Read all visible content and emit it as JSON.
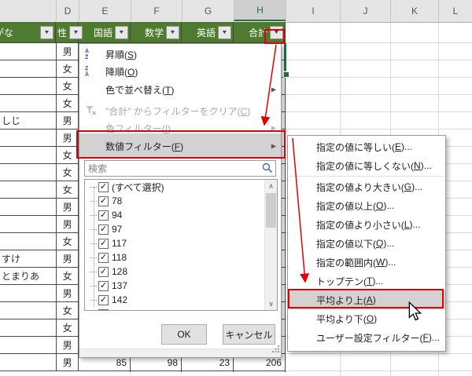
{
  "spreadsheet": {
    "column_letters": [
      "D",
      "E",
      "F",
      "G",
      "H",
      "I",
      "J",
      "K",
      "L"
    ],
    "selected_column": "H",
    "header_row": {
      "furigana": "がな",
      "sex": "性",
      "kokugo": "国語",
      "sugaku": "数学",
      "eigo": "英語",
      "gokei": "合計"
    },
    "rows": [
      {
        "furigana": "",
        "sex": "男"
      },
      {
        "furigana": "",
        "sex": "女"
      },
      {
        "furigana": "",
        "sex": "女"
      },
      {
        "furigana": "",
        "sex": "女"
      },
      {
        "furigana": "しじ",
        "sex": "男"
      },
      {
        "furigana": "",
        "sex": "男"
      },
      {
        "furigana": "",
        "sex": "女"
      },
      {
        "furigana": "",
        "sex": "女"
      },
      {
        "furigana": "",
        "sex": "女"
      },
      {
        "furigana": "",
        "sex": "男"
      },
      {
        "furigana": "",
        "sex": "男"
      },
      {
        "furigana": "",
        "sex": "女"
      },
      {
        "furigana": "すけ",
        "sex": "男"
      },
      {
        "furigana": "とまりあ",
        "sex": "女"
      },
      {
        "furigana": "",
        "sex": "男"
      },
      {
        "furigana": "",
        "sex": "女"
      },
      {
        "furigana": "",
        "sex": "女"
      },
      {
        "furigana": "",
        "sex": "男"
      },
      {
        "furigana": "",
        "sex": "男",
        "kokugo": "85",
        "sugaku": "98",
        "eigo": "23",
        "gokei": "206"
      }
    ]
  },
  "filter_menu": {
    "sort_asc": "昇順(S)",
    "sort_desc": "降順(O)",
    "sort_by_color": "色で並べ替え(T)",
    "clear_filter": "\"合計\" からフィルターをクリア(C)",
    "color_filter": "色フィルター(I)",
    "number_filter": "数値フィルター(F)",
    "search_placeholder": "検索",
    "checkbox_items": [
      "(すべて選択)",
      "78",
      "94",
      "97",
      "117",
      "118",
      "128",
      "137",
      "142"
    ],
    "ok_label": "OK",
    "cancel_label": "キャンセル"
  },
  "number_filter_submenu": {
    "items": [
      "指定の値に等しい(E)...",
      "指定の値に等しくない(N)...",
      "指定の値より大きい(G)...",
      "指定の値以上(O)...",
      "指定の値より小さい(L)...",
      "指定の値以下(Q)...",
      "指定の範囲内(W)...",
      "トップテン(T)...",
      "平均より上(A)",
      "平均より下(O)",
      "ユーザー設定フィルター(F)..."
    ],
    "highlighted_item": "平均より上(A)"
  },
  "colors": {
    "header_green": "#4E7B30",
    "selection_green": "#1E7145",
    "annotation_red": "#E30000",
    "menu_highlight": "#D2D2D2"
  }
}
